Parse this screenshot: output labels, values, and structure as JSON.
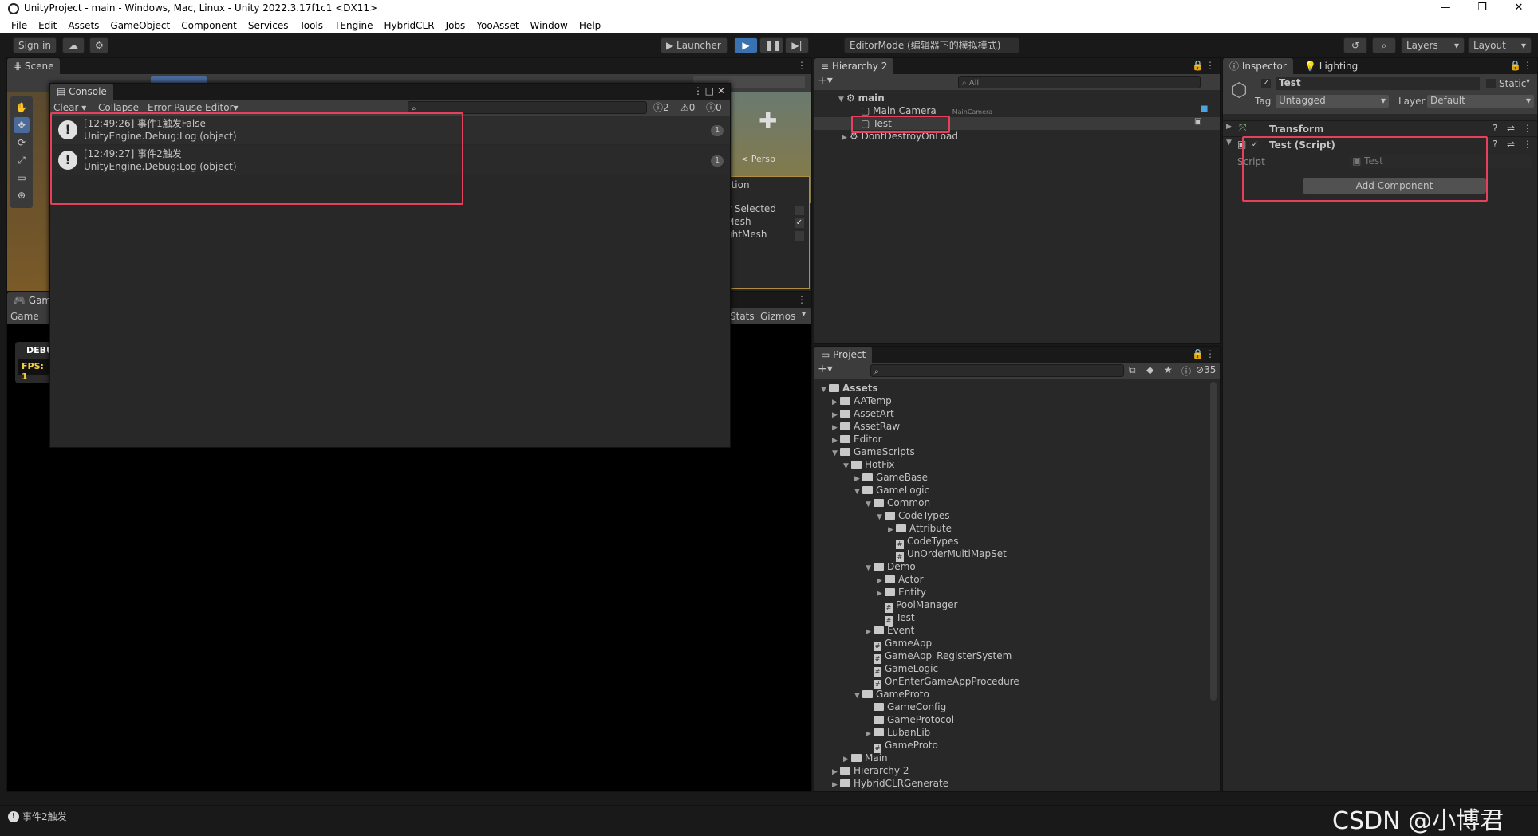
{
  "window": {
    "title": "UnityProject - main - Windows, Mac, Linux - Unity 2022.3.17f1c1 <DX11>",
    "controls": [
      "—",
      "❐",
      "✕"
    ]
  },
  "menu": [
    "File",
    "Edit",
    "Assets",
    "GameObject",
    "Component",
    "Services",
    "Tools",
    "TEngine",
    "HybridCLR",
    "Jobs",
    "YooAsset",
    "Window",
    "Help"
  ],
  "toolbar": {
    "sign_in": "Sign in",
    "launcher": "Launcher",
    "mode": "EditorMode (编辑器下的模拟模式)",
    "layers": "Layers",
    "layout": "Layout"
  },
  "scene": {
    "tab": "Scene",
    "game_tab": "Game",
    "game_label": "Game",
    "stats": "Stats",
    "gizmos": "Gizmos",
    "persp": "< Persp",
    "overlay_lines": [
      "ction",
      "y Selected",
      "Mesh",
      "ghtMesh"
    ],
    "debug": "DEBU",
    "fps": "FPS: 1"
  },
  "console": {
    "tab": "Console",
    "clear": "Clear",
    "collapse": "Collapse",
    "error_pause": "Error Pause",
    "editor": "Editor",
    "count_log": "2",
    "count_warn": "0",
    "count_err": "0",
    "entries": [
      {
        "line1": "[12:49:26] 事件1触发False",
        "line2": "UnityEngine.Debug:Log (object)",
        "count": "1"
      },
      {
        "line1": "[12:49:27] 事件2触发",
        "line2": "UnityEngine.Debug:Log (object)",
        "count": "1"
      }
    ]
  },
  "hierarchy": {
    "tab": "Hierarchy 2",
    "search_placeholder": "All",
    "items": [
      {
        "label": "main",
        "tag": ""
      },
      {
        "label": "Main Camera",
        "tag": "MainCamera"
      },
      {
        "label": "Test",
        "tag": ""
      },
      {
        "label": "DontDestroyOnLoad",
        "tag": ""
      }
    ]
  },
  "project": {
    "tab": "Project",
    "hidden_count": "35",
    "tree": [
      {
        "label": "Assets",
        "depth": 0,
        "kind": "folder",
        "open": "▼"
      },
      {
        "label": "AATemp",
        "depth": 1,
        "kind": "folder",
        "open": "▶"
      },
      {
        "label": "AssetArt",
        "depth": 1,
        "kind": "folder",
        "open": "▶"
      },
      {
        "label": "AssetRaw",
        "depth": 1,
        "kind": "folder",
        "open": "▶"
      },
      {
        "label": "Editor",
        "depth": 1,
        "kind": "folder",
        "open": "▶"
      },
      {
        "label": "GameScripts",
        "depth": 1,
        "kind": "folder",
        "open": "▼"
      },
      {
        "label": "HotFix",
        "depth": 2,
        "kind": "folder",
        "open": "▼"
      },
      {
        "label": "GameBase",
        "depth": 3,
        "kind": "folder",
        "open": "▶"
      },
      {
        "label": "GameLogic",
        "depth": 3,
        "kind": "folder",
        "open": "▼"
      },
      {
        "label": "Common",
        "depth": 4,
        "kind": "folder",
        "open": "▼"
      },
      {
        "label": "CodeTypes",
        "depth": 5,
        "kind": "folder",
        "open": "▼"
      },
      {
        "label": "Attribute",
        "depth": 6,
        "kind": "folder",
        "open": "▶"
      },
      {
        "label": "CodeTypes",
        "depth": 6,
        "kind": "cs",
        "open": ""
      },
      {
        "label": "UnOrderMultiMapSet",
        "depth": 6,
        "kind": "cs",
        "open": ""
      },
      {
        "label": "Demo",
        "depth": 4,
        "kind": "folder",
        "open": "▼"
      },
      {
        "label": "Actor",
        "depth": 5,
        "kind": "folder",
        "open": "▶"
      },
      {
        "label": "Entity",
        "depth": 5,
        "kind": "folder",
        "open": "▶"
      },
      {
        "label": "PoolManager",
        "depth": 5,
        "kind": "cs",
        "open": ""
      },
      {
        "label": "Test",
        "depth": 5,
        "kind": "cs",
        "open": ""
      },
      {
        "label": "Event",
        "depth": 4,
        "kind": "folder",
        "open": "▶"
      },
      {
        "label": "GameApp",
        "depth": 4,
        "kind": "cs",
        "open": ""
      },
      {
        "label": "GameApp_RegisterSystem",
        "depth": 4,
        "kind": "cs",
        "open": ""
      },
      {
        "label": "GameLogic",
        "depth": 4,
        "kind": "cs",
        "open": ""
      },
      {
        "label": "OnEnterGameAppProcedure",
        "depth": 4,
        "kind": "cs",
        "open": ""
      },
      {
        "label": "GameProto",
        "depth": 3,
        "kind": "folder",
        "open": "▼"
      },
      {
        "label": "GameConfig",
        "depth": 4,
        "kind": "folder",
        "open": ""
      },
      {
        "label": "GameProtocol",
        "depth": 4,
        "kind": "folder",
        "open": ""
      },
      {
        "label": "LubanLib",
        "depth": 4,
        "kind": "folder",
        "open": "▶"
      },
      {
        "label": "GameProto",
        "depth": 4,
        "kind": "cs",
        "open": ""
      },
      {
        "label": "Main",
        "depth": 2,
        "kind": "folder",
        "open": "▶"
      },
      {
        "label": "Hierarchy 2",
        "depth": 1,
        "kind": "folder",
        "open": "▶"
      },
      {
        "label": "HybridCLRGenerate",
        "depth": 1,
        "kind": "folder",
        "open": "▶"
      }
    ]
  },
  "inspector": {
    "tab": "Inspector",
    "lighting_tab": "Lighting",
    "object_name": "Test",
    "static_label": "Static",
    "tag_label": "Tag",
    "tag_value": "Untagged",
    "layer_label": "Layer",
    "layer_value": "Default",
    "transform": "Transform",
    "script_component": "Test (Script)",
    "script_label": "Script",
    "script_value": "Test",
    "add_component": "Add Component"
  },
  "status": {
    "message": "事件2触发"
  },
  "watermark": "CSDN @小博君"
}
